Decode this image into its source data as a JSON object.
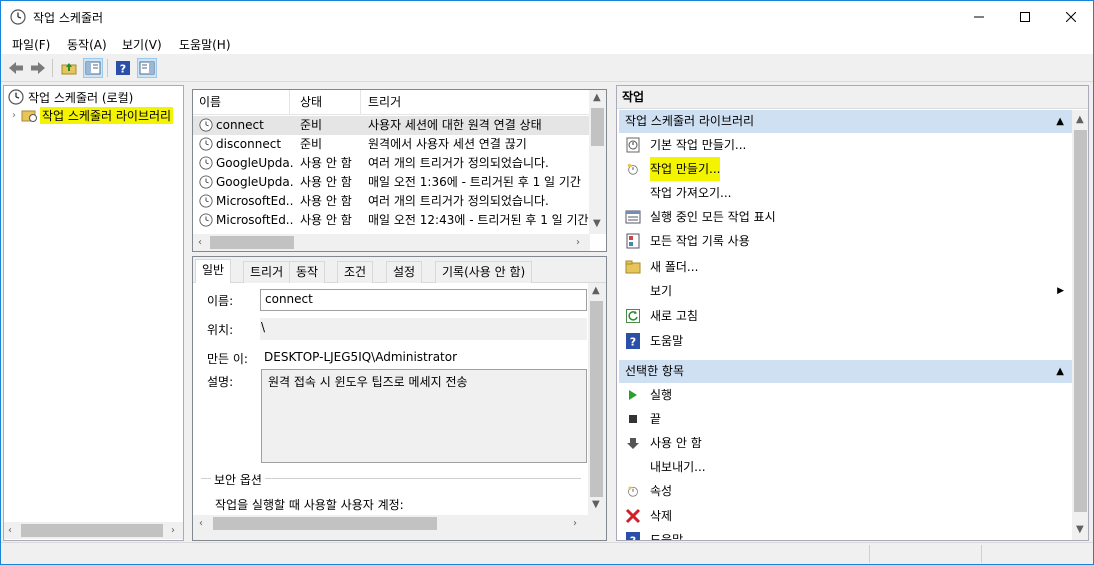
{
  "window": {
    "title": "작업 스케줄러",
    "controls": {
      "minimize": "minimize",
      "maximize": "maximize",
      "close": "close"
    }
  },
  "menu": [
    "파일(F)",
    "동작(A)",
    "보기(V)",
    "도움말(H)"
  ],
  "toolbar": [
    "back-icon",
    "forward-icon",
    "folder-up-icon",
    "console-tree-icon",
    "help-icon",
    "action-pane-icon"
  ],
  "tree": {
    "root": "작업 스케줄러 (로컬)",
    "child": "작업 스케줄러 라이브러리"
  },
  "task_list": {
    "columns": [
      "이름",
      "상태",
      "트리거"
    ],
    "rows": [
      {
        "name": "connect",
        "status": "준비",
        "trigger": "사용자 세션에 대한 원격 연결 상태"
      },
      {
        "name": "disconnect",
        "status": "준비",
        "trigger": "원격에서 사용자 세션 연결 끊기"
      },
      {
        "name": "GoogleUpda...",
        "status": "사용 안 함",
        "trigger": "여러 개의 트리거가 정의되었습니다."
      },
      {
        "name": "GoogleUpda...",
        "status": "사용 안 함",
        "trigger": "매일 오전 1:36에 - 트리거된 후 1 일 기간"
      },
      {
        "name": "MicrosoftEd...",
        "status": "사용 안 함",
        "trigger": "여러 개의 트리거가 정의되었습니다."
      },
      {
        "name": "MicrosoftEd...",
        "status": "사용 안 함",
        "trigger": "매일 오전 12:43에 - 트리거된 후 1 일 기간"
      }
    ]
  },
  "detail": {
    "tabs": [
      "일반",
      "트리거",
      "동작",
      "조건",
      "설정",
      "기록(사용 안 함)"
    ],
    "fields": {
      "name_label": "이름:",
      "name_value": "connect",
      "location_label": "위치:",
      "location_value": "\\",
      "author_label": "만든 이:",
      "author_value": "DESKTOP-LJEG5IQ\\Administrator",
      "description_label": "설명:",
      "description_value": "원격 접속 시 윈도우 팁즈로 메세지 전송"
    },
    "security": {
      "title": "보안 옵션",
      "account_text": "작업을 실행할 때 사용할 사용자 계정:"
    }
  },
  "actions": {
    "header": "작업",
    "section1": {
      "title": "작업 스케줄러 라이브러리",
      "items": [
        {
          "label": "기본 작업 만들기...",
          "icon": "basic-task-icon"
        },
        {
          "label": "작업 만들기...",
          "icon": "create-task-icon"
        },
        {
          "label": "작업 가져오기...",
          "icon": ""
        },
        {
          "label": "실행 중인 모든 작업 표시",
          "icon": "running-tasks-icon"
        },
        {
          "label": "모든 작업 기록 사용",
          "icon": "history-icon"
        },
        {
          "label": "새 폴더...",
          "icon": "new-folder-icon"
        },
        {
          "label": "보기",
          "icon": ""
        },
        {
          "label": "새로 고침",
          "icon": "refresh-icon"
        },
        {
          "label": "도움말",
          "icon": "help-icon"
        }
      ]
    },
    "section2": {
      "title": "선택한 항목",
      "items": [
        {
          "label": "실행",
          "icon": "run-icon"
        },
        {
          "label": "끝",
          "icon": "end-icon"
        },
        {
          "label": "사용 안 함",
          "icon": "disable-icon"
        },
        {
          "label": "내보내기...",
          "icon": ""
        },
        {
          "label": "속성",
          "icon": "properties-icon"
        },
        {
          "label": "삭제",
          "icon": "delete-icon"
        },
        {
          "label": "도움말",
          "icon": "help-icon"
        }
      ]
    }
  },
  "colors": {
    "highlight": "#f4f400",
    "section_header": "#cfe0f2",
    "window_border": "#1883d7"
  }
}
